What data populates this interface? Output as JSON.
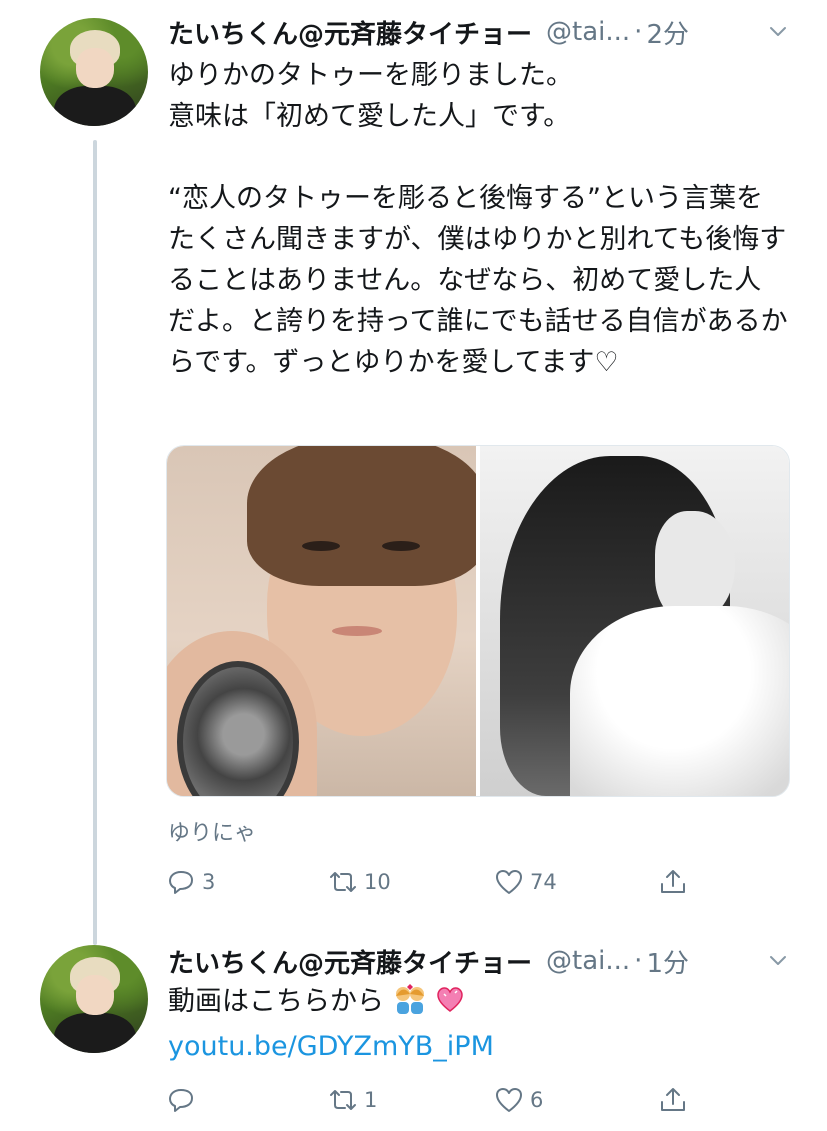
{
  "tweets": [
    {
      "display_name": "たいちくん@元斉藤タイチョー",
      "handle": "@tai...",
      "separator": "·",
      "time": "2分",
      "text": "ゆりかのタトゥーを彫りました。\n意味は「初めて愛した人」です。\n\n“恋人のタトゥーを彫ると後悔する”という言葉をたくさん聞きますが、僕はゆりかと別れても後悔することはありません。なぜなら、初めて愛した人だよ。と誇りを持って誰にでも話せる自信があるからです。ずっとゆりかを愛してます♡",
      "media_caption": "ゆりにゃ",
      "reply_count": "3",
      "retweet_count": "10",
      "like_count": "74"
    },
    {
      "display_name": "たいちくん@元斉藤タイチョー",
      "handle": "@tai...",
      "separator": "·",
      "time": "1分",
      "text": "動画はこちらから",
      "link": "youtu.be/GDYZmYB_iPM",
      "reply_count": "",
      "retweet_count": "1",
      "like_count": "6"
    }
  ],
  "colors": {
    "link": "#1b95e0",
    "muted": "#657786",
    "text": "#14171a",
    "thread_line": "#ccd6dd"
  },
  "icons": [
    "reply-icon",
    "retweet-icon",
    "like-icon",
    "share-icon",
    "chevron-down-icon"
  ]
}
